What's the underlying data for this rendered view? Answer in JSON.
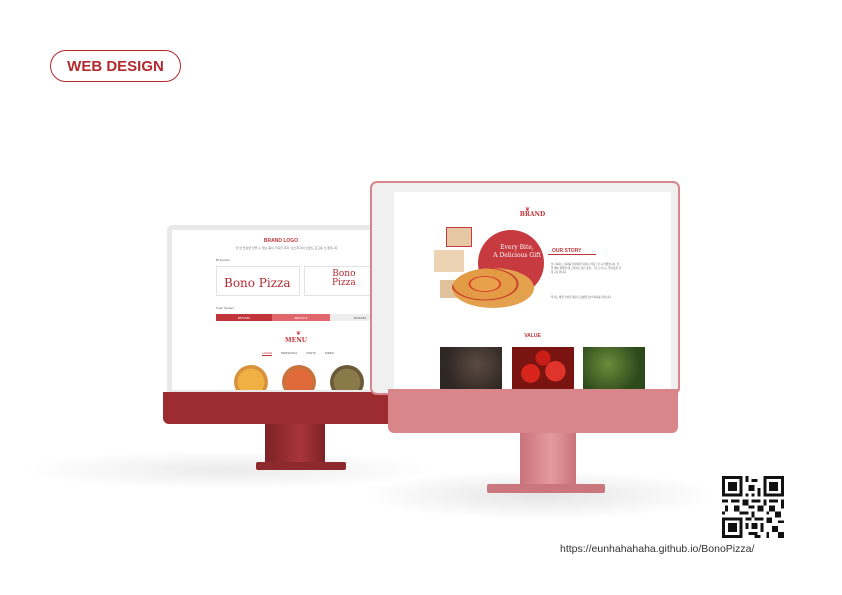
{
  "badge": {
    "label": "WEB DESIGN"
  },
  "colors": {
    "accent": "#b22a2f",
    "monitor_left": "#9c2c30",
    "monitor_right": "#d9868b"
  },
  "left_screen": {
    "title": "BRAND LOGO",
    "description": "한 번 맛보면 잊을 수 없는 풍미 가득한 피자. 보노피자의 브랜드 로고를 소개합니다.",
    "section_label": "BI Symbol",
    "logo_primary": "Bono Pizza",
    "logo_secondary_line1": "Bono",
    "logo_secondary_line2": "Pizza",
    "color_label": "Color System",
    "swatches": [
      {
        "label": "#B72F3F",
        "color": "#c0343a"
      },
      {
        "label": "#ED7C7F",
        "color": "#e0686c"
      },
      {
        "label": "#E5E5E5",
        "color": "#eeeeee"
      }
    ],
    "menu_title": "MENU",
    "tabs": [
      "LARGE",
      "PERSONAL",
      "PASTA",
      "SIDES"
    ]
  },
  "right_screen": {
    "brand": "BRAND",
    "tagline_line1": "Every Bite,",
    "tagline_line2": "A Delicious Gift",
    "story_title": "OUR STORY",
    "story_p1": "보노피자는 '피자를 선물처럼' 이라는 마음으로 시작했습니다. 한 입 베어 물었을 때 느껴지는 깊은 풍미, 그리고 나누는 즐거움을 전하고자 합니다.",
    "story_p2": "우리는 매일 신선한 재료로 정성을 담아 피자를 만듭니다.",
    "value_title": "VALUE"
  },
  "qr": {
    "icon": "qr-code-icon"
  },
  "url": "https://eunhahahaha.github.io/BonoPizza/"
}
